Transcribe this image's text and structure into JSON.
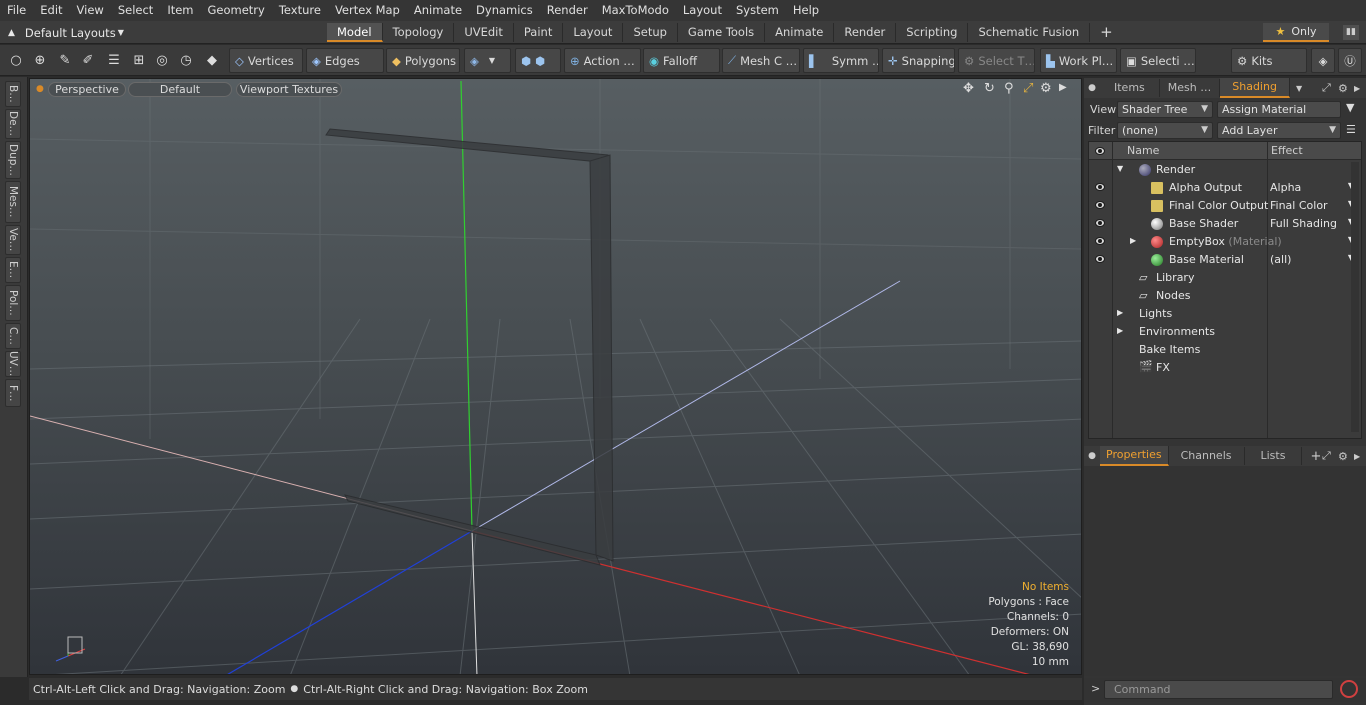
{
  "menu": [
    "File",
    "Edit",
    "View",
    "Select",
    "Item",
    "Geometry",
    "Texture",
    "Vertex Map",
    "Animate",
    "Dynamics",
    "Render",
    "MaxToModo",
    "Layout",
    "System",
    "Help"
  ],
  "layout": {
    "selector": "Default Layouts",
    "tabs": [
      "Model",
      "Topology",
      "UVEdit",
      "Paint",
      "Layout",
      "Setup",
      "Game Tools",
      "Animate",
      "Render",
      "Scripting",
      "Schematic Fusion"
    ],
    "active_tab": "Model",
    "only_label": "Only"
  },
  "toolbar": {
    "vertices": "Vertices",
    "edges": "Edges",
    "polygons": "Polygons",
    "action": "Action …",
    "falloff": "Falloff",
    "mesh": "Mesh C …",
    "symm": "Symm …",
    "snapping": "Snapping",
    "select_t": "Select T…",
    "work_pl": "Work Pl…",
    "selecti": "Selecti …",
    "kits": "Kits"
  },
  "left_tabs": [
    "B…",
    "De…",
    "Dup…",
    "Mes…",
    "Ve…",
    "E…",
    "Pol…",
    "C…",
    "UV…",
    "F…"
  ],
  "viewport": {
    "perspective": "Perspective",
    "default": "Default",
    "textures": "Viewport Textures",
    "info": {
      "no_items": "No Items",
      "polygons": "Polygons : Face",
      "channels": "Channels: 0",
      "deformers": "Deformers: ON",
      "gl": "GL: 38,690",
      "scale": "10 mm"
    }
  },
  "status": {
    "left": "Ctrl-Alt-Left Click and Drag: Navigation: Zoom",
    "right": "Ctrl-Alt-Right Click and Drag: Navigation: Box Zoom"
  },
  "panel": {
    "tabs": [
      "Items",
      "Mesh …",
      "Shading"
    ],
    "active_tab": "Shading",
    "view_label": "View",
    "view_value": "Shader Tree",
    "assign": "Assign Material",
    "filter_label": "Filter",
    "filter_value": "(none)",
    "add_layer": "Add Layer",
    "col_name": "Name",
    "col_effect": "Effect",
    "rows": [
      {
        "name": "Render",
        "effect": ""
      },
      {
        "name": "Alpha Output",
        "effect": "Alpha"
      },
      {
        "name": "Final Color Output",
        "effect": "Final Color"
      },
      {
        "name": "Base Shader",
        "effect": "Full Shading"
      },
      {
        "name": "EmptyBox",
        "suffix": "(Material)",
        "effect": ""
      },
      {
        "name": "Base Material",
        "effect": "(all)"
      },
      {
        "name": "Library",
        "effect": ""
      },
      {
        "name": "Nodes",
        "effect": ""
      },
      {
        "name": "Lights",
        "effect": ""
      },
      {
        "name": "Environments",
        "effect": ""
      },
      {
        "name": "Bake Items",
        "effect": ""
      },
      {
        "name": "FX",
        "effect": ""
      }
    ],
    "prop_tabs": [
      "Properties",
      "Channels",
      "Lists"
    ],
    "active_prop_tab": "Properties",
    "command_placeholder": "Command"
  },
  "colors": {
    "accent": "#d98a28",
    "x_axis": "#e04040",
    "y_axis": "#40d040",
    "z_axis": "#3050e0"
  }
}
